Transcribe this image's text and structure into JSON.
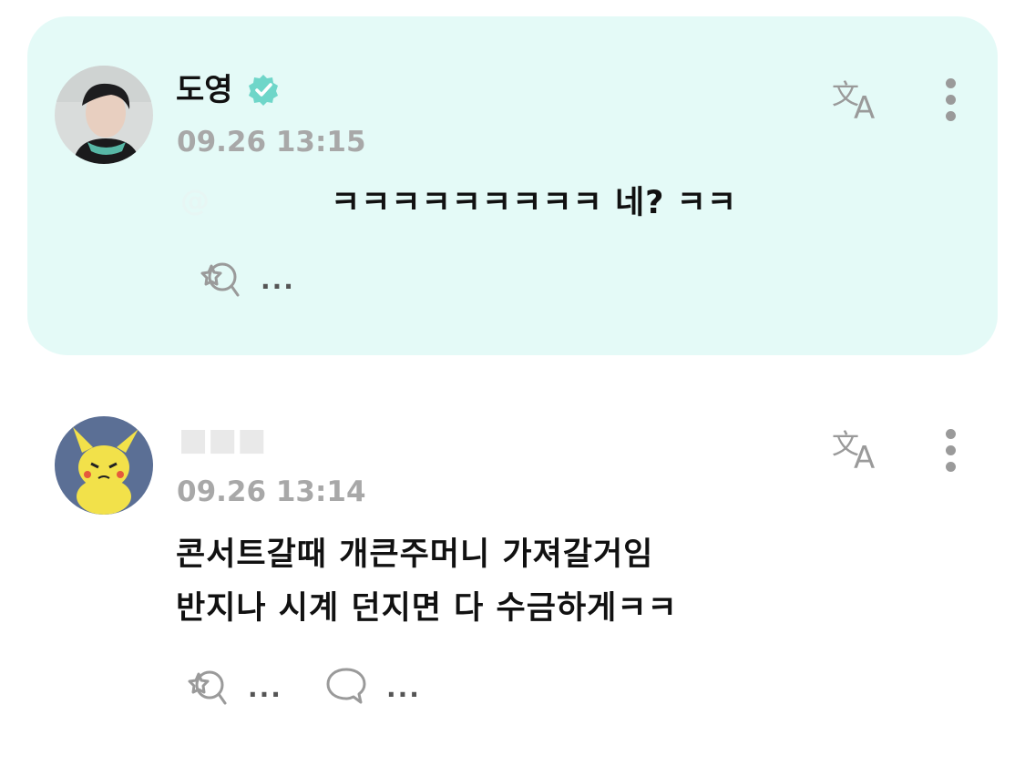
{
  "pinned_reply": {
    "author": "도영",
    "verified": true,
    "timestamp": "09.26 13:15",
    "text": "ㅋㅋㅋㅋㅋㅋㅋㅋㅋ 네? ㅋㅋ",
    "reaction_count": "...",
    "background": "#e4faf7",
    "accent": "#6fd6c9"
  },
  "post": {
    "timestamp": "09.26 13:14",
    "text_line1": "콘서트갈때 개큰주머니 가져갈거임",
    "text_line2": "반지나 시계 던지면 다 수금하게ㅋㅋ",
    "reaction_count": "...",
    "comment_count": "..."
  },
  "icons": {
    "translate": "translate-icon",
    "more": "more-vertical-icon",
    "react": "add-reaction-icon",
    "comment": "comment-bubble-icon",
    "verified": "verified-badge-icon"
  }
}
